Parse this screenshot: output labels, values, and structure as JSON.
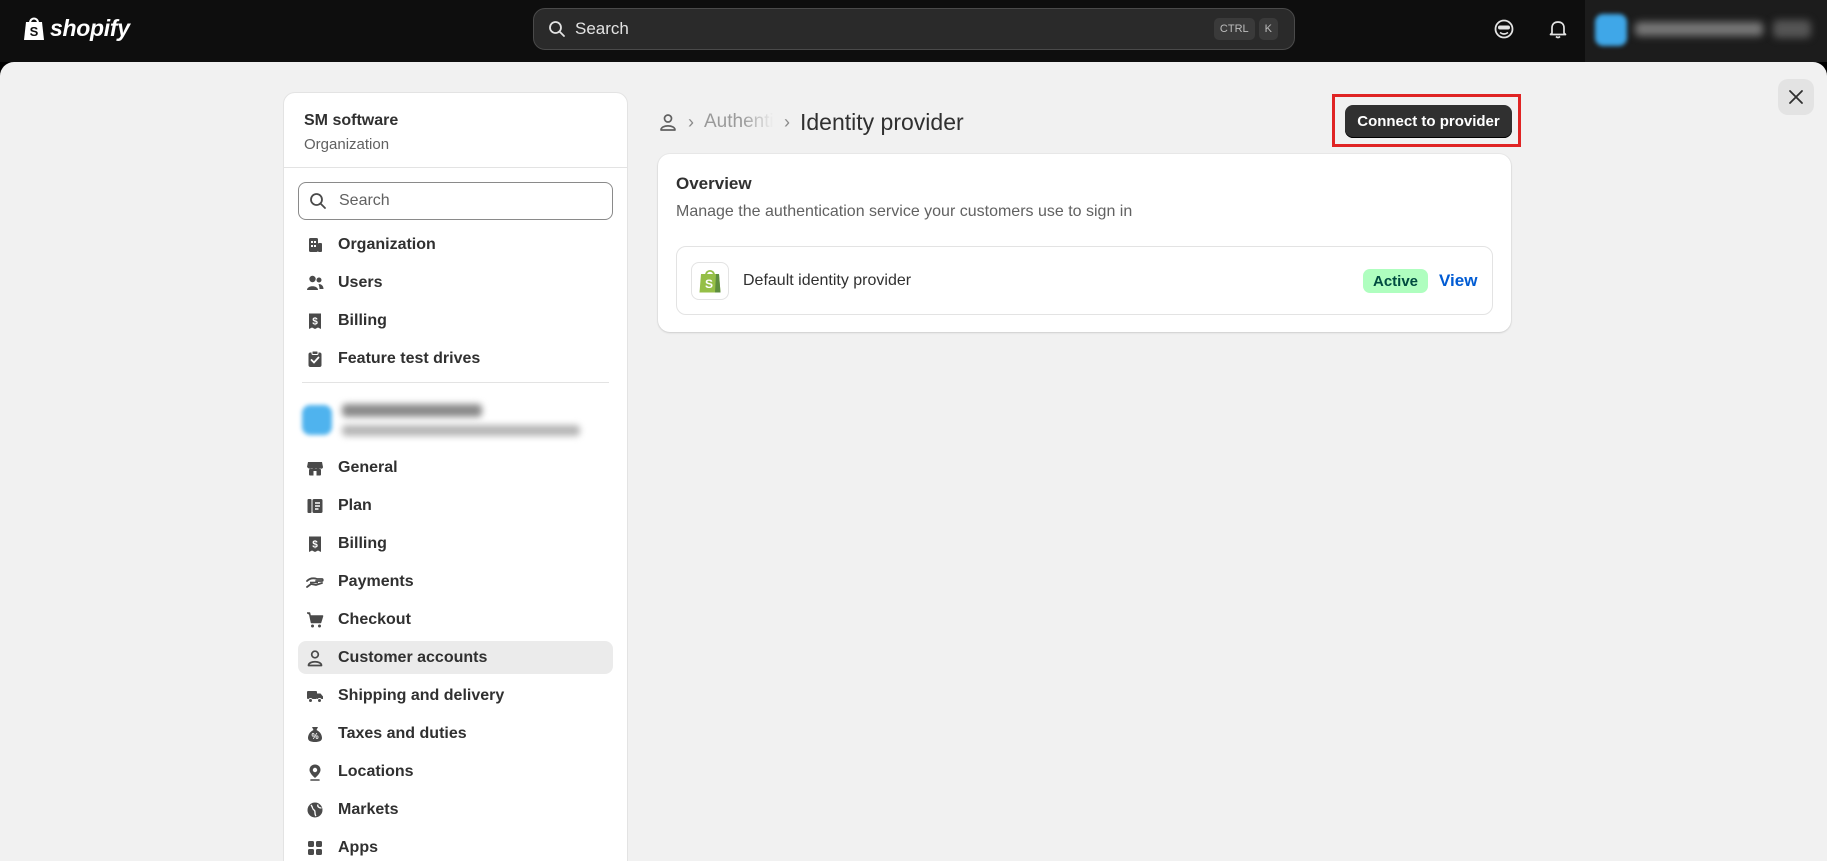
{
  "topbar": {
    "logo_text": "shopify",
    "search_placeholder": "Search",
    "shortcut_keys": [
      "CTRL",
      "K"
    ],
    "icons": [
      "sidekick-icon",
      "bell-icon"
    ]
  },
  "sidebar": {
    "org_name": "SM software",
    "org_type": "Organization",
    "search_placeholder": "Search",
    "org_items": [
      {
        "label": "Organization",
        "icon": "building-icon"
      },
      {
        "label": "Users",
        "icon": "users-icon"
      },
      {
        "label": "Billing",
        "icon": "receipt-icon"
      },
      {
        "label": "Feature test drives",
        "icon": "clipboard-check-icon"
      }
    ],
    "store_items": [
      {
        "label": "General",
        "icon": "store-icon"
      },
      {
        "label": "Plan",
        "icon": "plan-icon"
      },
      {
        "label": "Billing",
        "icon": "receipt-icon"
      },
      {
        "label": "Payments",
        "icon": "payments-icon"
      },
      {
        "label": "Checkout",
        "icon": "cart-icon"
      },
      {
        "label": "Customer accounts",
        "icon": "person-icon"
      },
      {
        "label": "Shipping and delivery",
        "icon": "truck-icon"
      },
      {
        "label": "Taxes and duties",
        "icon": "tax-icon"
      },
      {
        "label": "Locations",
        "icon": "location-icon"
      },
      {
        "label": "Markets",
        "icon": "globe-icon"
      },
      {
        "label": "Apps",
        "icon": "apps-icon"
      }
    ],
    "active_item": "Customer accounts"
  },
  "breadcrumb": {
    "parent": "Authentication",
    "current": "Identity provider"
  },
  "header": {
    "primary_action": "Connect to provider"
  },
  "overview": {
    "title": "Overview",
    "description": "Manage the authentication service your customers use to sign in",
    "provider": {
      "name": "Default identity provider",
      "status": "Active",
      "action": "View"
    }
  },
  "colors": {
    "highlight_box": "#e02424",
    "active_badge_bg": "#affebf",
    "link": "#005bd3"
  }
}
